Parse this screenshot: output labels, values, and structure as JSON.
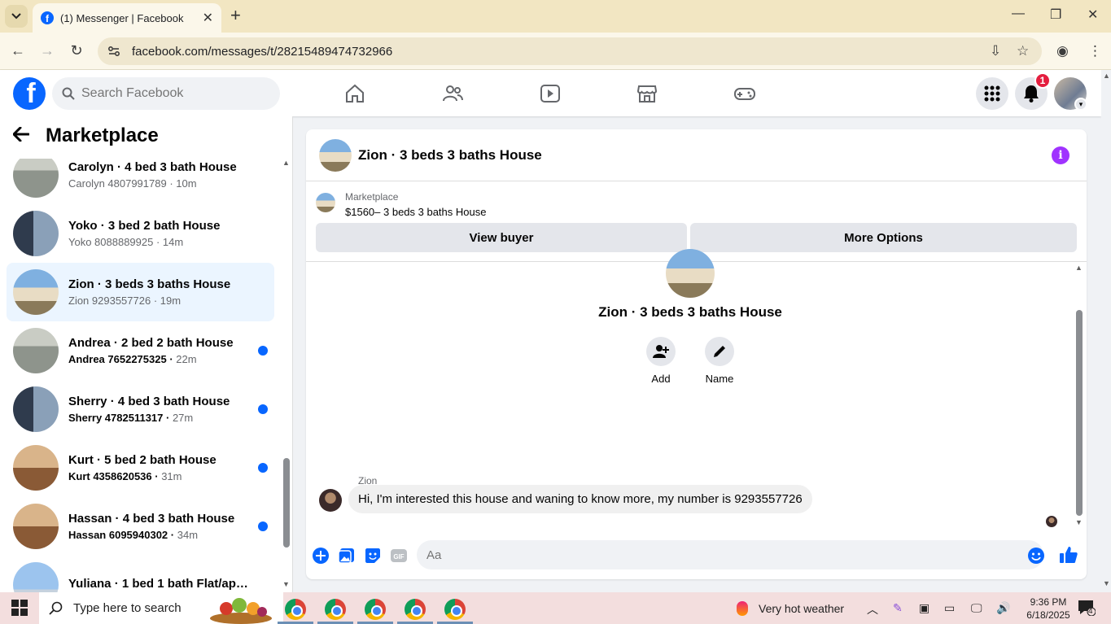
{
  "browser": {
    "tab_title": "(1) Messenger | Facebook",
    "url": "facebook.com/messages/t/28215489474732966"
  },
  "fb_header": {
    "search_placeholder": "Search Facebook",
    "notification_count": "1"
  },
  "left_panel": {
    "title": "Marketplace",
    "conversations": [
      {
        "name": "Carolyn · 4 bed 3 bath House",
        "sub": "Carolyn 4807991789",
        "time": "10m",
        "unread": false,
        "active": false
      },
      {
        "name": "Yoko · 3 bed 2 bath House",
        "sub": "Yoko 8088889925",
        "time": "14m",
        "unread": false,
        "active": false
      },
      {
        "name": "Zion · 3 beds 3 baths House",
        "sub": "Zion 9293557726",
        "time": "19m",
        "unread": false,
        "active": true
      },
      {
        "name": "Andrea · 2 bed 2 bath House",
        "sub": "Andrea 7652275325",
        "time": "22m",
        "unread": true,
        "active": false
      },
      {
        "name": "Sherry · 4 bed 3 bath House",
        "sub": "Sherry 4782511317",
        "time": "27m",
        "unread": true,
        "active": false
      },
      {
        "name": "Kurt · 5 bed 2 bath House",
        "sub": "Kurt 4358620536",
        "time": "31m",
        "unread": true,
        "active": false
      },
      {
        "name": "Hassan · 4 bed 3 bath House",
        "sub": "Hassan 6095940302",
        "time": "34m",
        "unread": true,
        "active": false
      },
      {
        "name": "Yuliana · 1 bed 1 bath Flat/apart...",
        "sub": "",
        "time": "",
        "unread": false,
        "active": false
      }
    ]
  },
  "chat": {
    "title": "Zion · 3 beds 3 baths House",
    "marketplace_label": "Marketplace",
    "listing": "$1560– 3 beds 3 baths House",
    "view_buyer_label": "View buyer",
    "more_options_label": "More Options",
    "body_title": "Zion · 3 beds 3 baths House",
    "add_label": "Add",
    "name_label": "Name",
    "sender": "Zion",
    "message": "Hi, I'm interested this house and waning to know more, my number is 9293557726",
    "composer_placeholder": "Aa"
  },
  "taskbar": {
    "search_placeholder": "Type here to search",
    "weather": "Very hot weather",
    "time": "9:36 PM",
    "date": "6/18/2025",
    "notification_count": "4"
  },
  "colors": {
    "fb_blue": "#0866ff",
    "active_row": "#ebf5ff",
    "info_purple": "#a033ff",
    "badge_red": "#e41e3f"
  }
}
